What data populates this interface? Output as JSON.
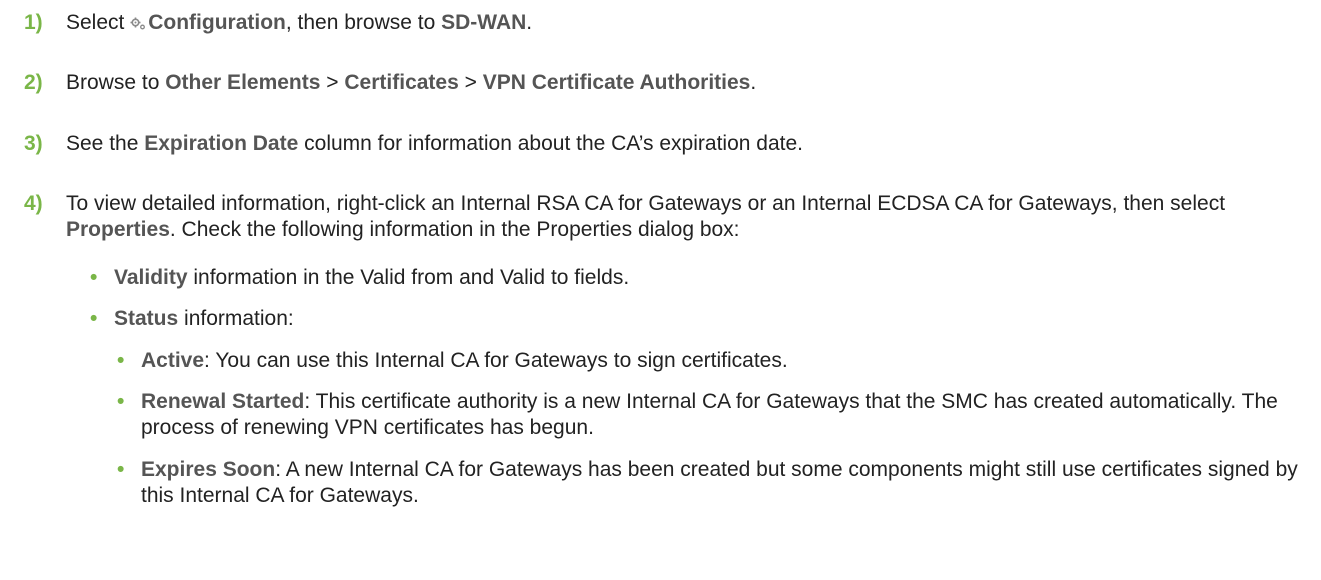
{
  "steps": [
    {
      "number": "1)",
      "select": "Select",
      "gear_icon": "gear-icon",
      "configuration": "Configuration",
      "then_browse": ", then browse to",
      "sdwan": "SD-WAN",
      "period": "."
    },
    {
      "number": "2)",
      "browse_to": "Browse to",
      "other_elements": "Other Elements",
      "sep1": ">",
      "certificates": "Certificates",
      "sep2": ">",
      "vpn_cas": "VPN Certificate Authorities",
      "period": "."
    },
    {
      "number": "3)",
      "see_the": "See the",
      "expiration_date": "Expiration Date",
      "rest": "column for information about the CA’s expiration date."
    },
    {
      "number": "4)",
      "intro": "To view detailed information, right-click an Internal RSA CA for Gateways or an Internal ECDSA CA for Gateways, then select",
      "properties": "Properties",
      "rest": ". Check the following information in the Properties dialog box:"
    }
  ],
  "bullets": {
    "validity_term": "Validity",
    "validity_text": "information in the Valid from and Valid to fields.",
    "status_term": "Status",
    "status_text": "information:"
  },
  "status_items": [
    {
      "term": "Active",
      "text": ": You can use this Internal CA for Gateways to sign certificates."
    },
    {
      "term": "Renewal Started",
      "text": ": This certificate authority is a new Internal CA for Gateways that the SMC has created automatically. The process of renewing VPN certificates has begun."
    },
    {
      "term": "Expires Soon",
      "text": ": A new Internal CA for Gateways has been created but some components might still use certificates signed by this Internal CA for Gateways."
    }
  ],
  "bullet_symbol": "•",
  "colors": {
    "accent": "#7ab648",
    "ui_term": "#555555",
    "body_text": "#222222"
  }
}
